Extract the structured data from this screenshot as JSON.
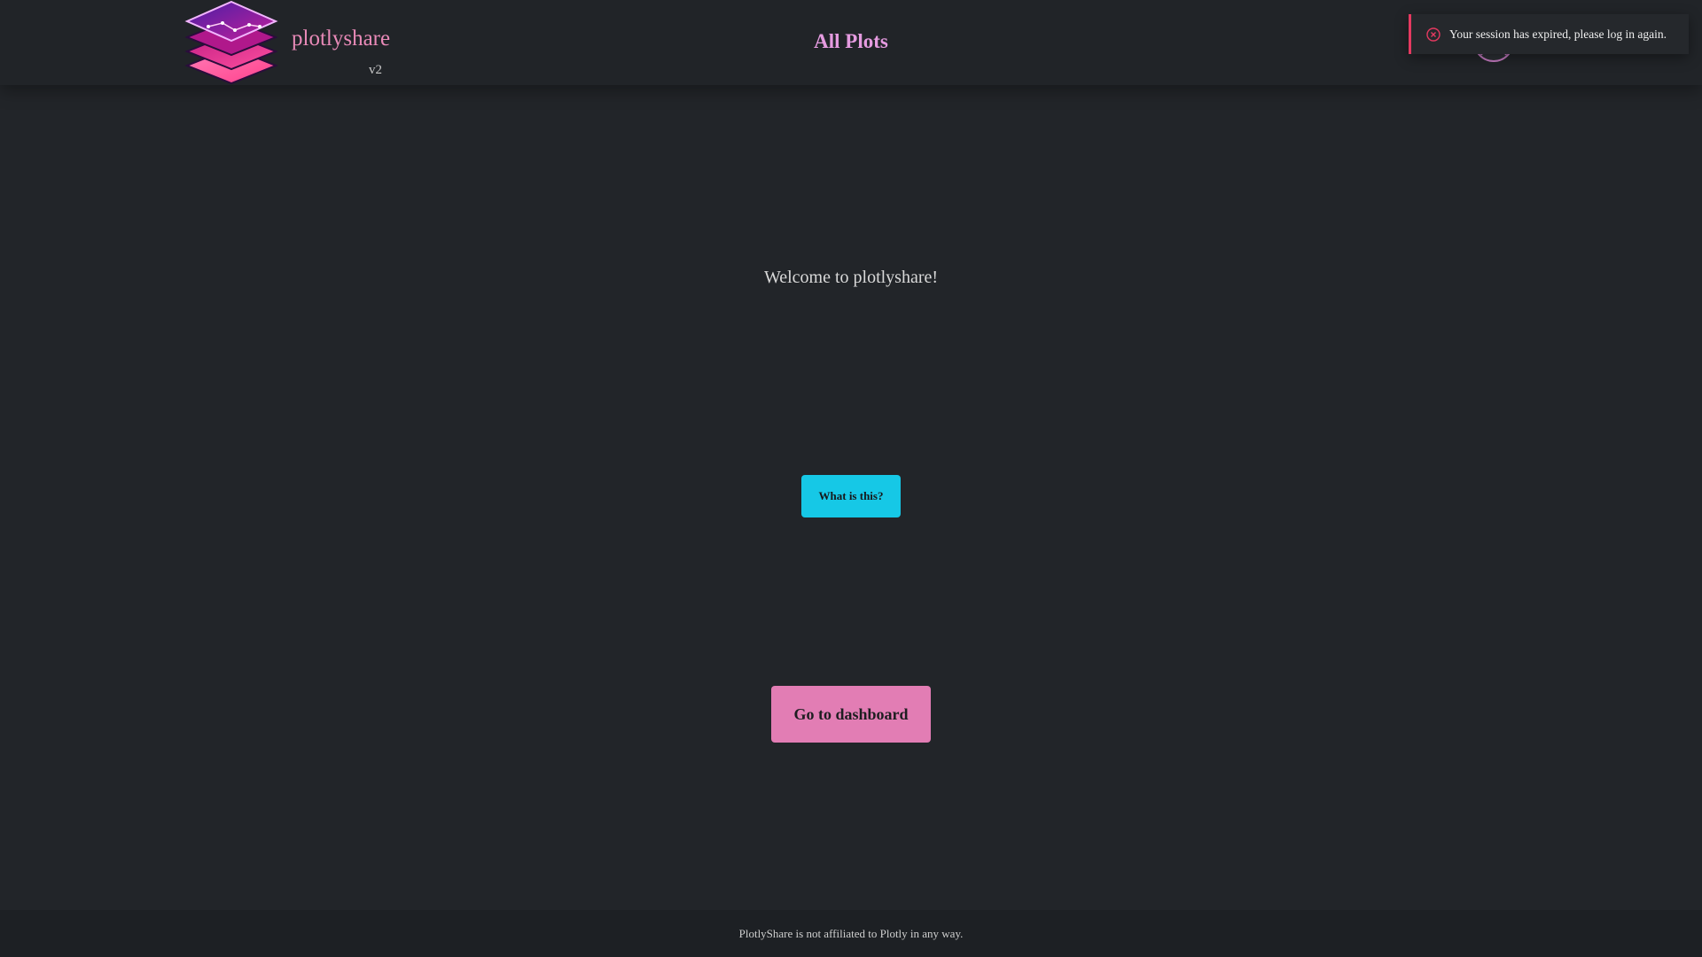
{
  "header": {
    "brand_name": "plotlyshare",
    "brand_version": "v2",
    "nav_title": "All Plots"
  },
  "toast": {
    "message": "Your session has expired, please log in again."
  },
  "main": {
    "welcome_text": "Welcome to plotlyshare!",
    "what_button_label": "What is this?",
    "dashboard_button_label": "Go to dashboard"
  },
  "footer": {
    "disclaimer": "PlotlyShare is not affiliated to Plotly in any way."
  },
  "colors": {
    "background": "#222529",
    "brand_pink": "#e98ab8",
    "nav_title": "#e59be0",
    "cyan_button": "#16c8e6",
    "pink_button": "#e27db4",
    "toast_error": "#e53960"
  },
  "icons": {
    "logo": "stacked-layers-logo",
    "toast": "error-circle-x-icon",
    "avatar": "user-avatar-icon"
  }
}
